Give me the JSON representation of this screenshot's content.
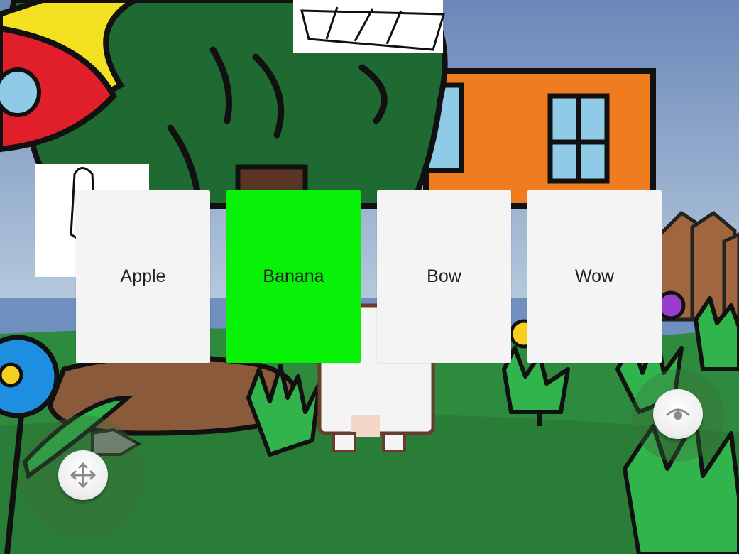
{
  "choices": [
    {
      "label": "Apple",
      "color": "#f4f4f4",
      "selected": false
    },
    {
      "label": "Banana",
      "color": "#08f208",
      "selected": true
    },
    {
      "label": "Bow",
      "color": "#f4f4f4",
      "selected": false
    },
    {
      "label": "Wow",
      "color": "#f4f4f4",
      "selected": false
    }
  ],
  "controls": {
    "move_icon": "move-arrows-icon",
    "look_icon": "eye-icon"
  },
  "colors": {
    "sky": "#6f8fbf",
    "grass": "#2e8a3c",
    "house": "#f07c20",
    "tree": "#1f6a32",
    "selected_card": "#08f208",
    "card": "#f4f4f4"
  }
}
